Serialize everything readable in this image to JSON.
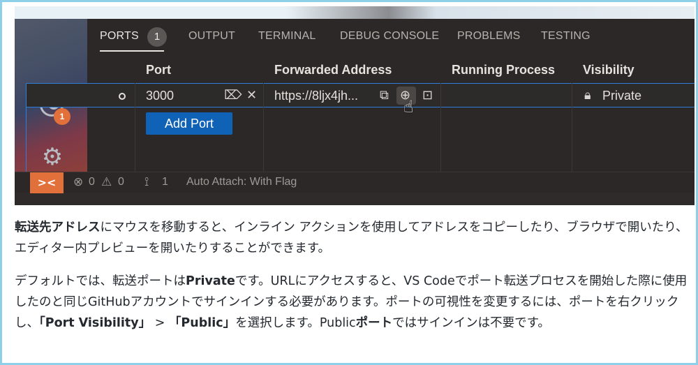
{
  "panel": {
    "tabs": [
      {
        "label": "PORTS",
        "badge": "1"
      },
      {
        "label": "OUTPUT"
      },
      {
        "label": "TERMINAL"
      },
      {
        "label": "DEBUG CONSOLE"
      },
      {
        "label": "PROBLEMS"
      },
      {
        "label": "TESTING"
      }
    ],
    "columns": [
      "Port",
      "Forwarded Address",
      "Running Process",
      "Visibility"
    ],
    "row": {
      "port": "3000",
      "address": "https://8ljx4jh...",
      "process": "",
      "visibility": "Private"
    },
    "add_port_label": "Add Port"
  },
  "activity": {
    "account_badge": "1"
  },
  "statusbar": {
    "errors": "0",
    "warnings": "0",
    "ports": "1",
    "auto_attach": "Auto Attach: With Flag"
  },
  "article": {
    "p1_bold": "転送先アドレス",
    "p1_rest": "にマウスを移動すると、インライン アクションを使用してアドレスをコピーしたり、ブラウザで開いたり、エディター内プレビューを開いたりすることができます。",
    "p2_a": "デフォルトでは、転送ポートは",
    "p2_b_bold": "Private",
    "p2_c": "です。URLにアクセスすると、VS Codeでポート転送プロセスを開始した際に使用したのと同じGitHubアカウントでサインインする必要があります。ポートの可視性を変更するには、ポートを右クリックし、",
    "p2_d_bold": "「Port Visibility」",
    "p2_e": " > ",
    "p2_f_bold": "「Public」",
    "p2_g": "を選択します。Public",
    "p2_h_bold": "ポート",
    "p2_i": "ではサインインは不要です。"
  }
}
